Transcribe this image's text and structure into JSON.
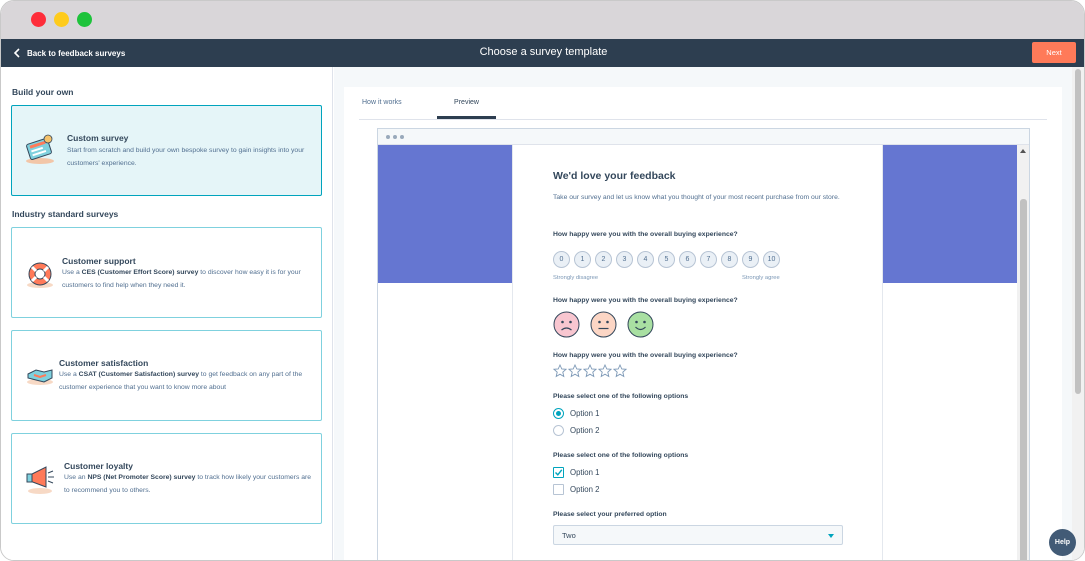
{
  "header": {
    "back_label": "Back to feedback surveys",
    "title": "Choose a survey template",
    "next_label": "Next"
  },
  "left": {
    "build_heading": "Build your own",
    "industry_heading": "Industry standard surveys",
    "custom": {
      "title": "Custom survey",
      "desc": "Start from scratch and build your own bespoke survey to gain insights into your customers' experience.",
      "icon": "custom-survey-icon"
    },
    "support": {
      "title": "Customer support",
      "desc_pre": "Use a ",
      "desc_bold": "CES (Customer Effort Score) survey",
      "desc_post": " to discover how easy it is for your customers to find help when they need it.",
      "icon": "lifebuoy-icon"
    },
    "satisfaction": {
      "title": "Customer satisfaction",
      "desc_pre": "Use a ",
      "desc_bold": "CSAT (Customer Satisfaction) survey",
      "desc_post": " to get feedback on any part of the customer experience that you want to know more about",
      "icon": "handshake-icon"
    },
    "loyalty": {
      "title": "Customer loyalty",
      "desc_pre": "Use an ",
      "desc_bold": "NPS (Net Promoter Score) survey",
      "desc_post": " to track how likely your customers are to recommend you to others.",
      "icon": "megaphone-icon"
    }
  },
  "tabs": {
    "how_it_works": "How it works",
    "preview": "Preview",
    "active": "Preview"
  },
  "survey": {
    "title": "We'd love your feedback",
    "intro": "Take our survey and let us know what you thought of your most recent purchase from our store.",
    "q1": "How happy were you with the overall buying experience?",
    "nps_values": [
      "0",
      "1",
      "2",
      "3",
      "4",
      "5",
      "6",
      "7",
      "8",
      "9",
      "10"
    ],
    "low_label": "Strongly disagree",
    "high_label": "Strongly agree",
    "q2": "How happy were you with the overall buying experience?",
    "q3": "How happy were you with the overall buying experience?",
    "star_count": 5,
    "q4": "Please select one of the following options",
    "radio_options": [
      "Option 1",
      "Option 2"
    ],
    "radio_selected": "Option 1",
    "q5": "Please select one of the following options",
    "check_options": [
      "Option 1",
      "Option 2"
    ],
    "check_selected": [
      "Option 1"
    ],
    "q6": "Please select your preferred option",
    "select_value": "Two"
  },
  "help_label": "Help",
  "colors": {
    "header_bg": "#2d3e50",
    "accent_orange": "#ff7a59",
    "accent_teal": "#00a4bd",
    "band_blue": "#6576d1"
  }
}
